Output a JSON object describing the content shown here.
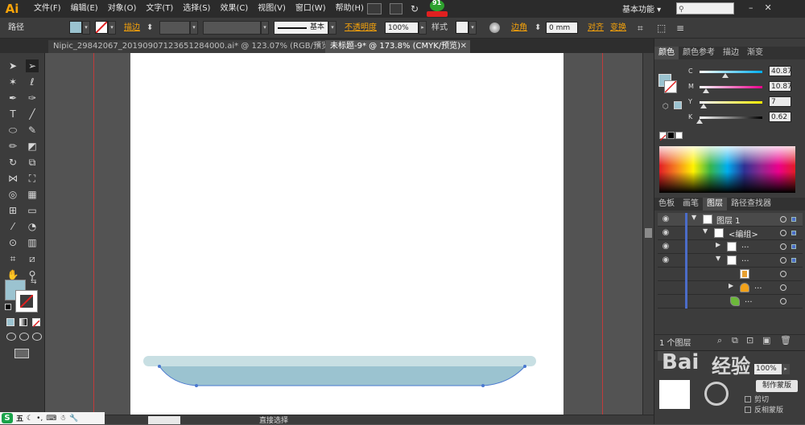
{
  "app": {
    "logo": "Ai"
  },
  "menu": {
    "items": [
      "文件(F)",
      "编辑(E)",
      "对象(O)",
      "文字(T)",
      "选择(S)",
      "效果(C)",
      "视图(V)",
      "窗口(W)",
      "帮助(H)"
    ],
    "workspace": "基本功能",
    "badge": "91"
  },
  "controlbar": {
    "selection_label": "路径",
    "stroke_label": "描边",
    "stroke_style": "基本",
    "opacity_label": "不透明度",
    "opacity_value": "100%",
    "style_label": "样式",
    "corner_label": "边角",
    "corner_value": "0 mm",
    "align_label": "对齐",
    "transform_label": "变换",
    "fill_color": "#9bc3d0"
  },
  "tabs": [
    {
      "label": "Nipic_29842067_20190907123651284000.ai* @ 123.07% (RGB/预览)",
      "active": false
    },
    {
      "label": "未标题-9* @ 173.8% (CMYK/预览)",
      "active": true
    }
  ],
  "color_panel": {
    "tabs": [
      "颜色",
      "颜色参考",
      "描边",
      "渐变"
    ],
    "active_tab": "颜色",
    "sliders": [
      {
        "channel": "C",
        "value": "40.87",
        "percent": 40.87
      },
      {
        "channel": "M",
        "value": "10.87",
        "percent": 10.87
      },
      {
        "channel": "Y",
        "value": "7",
        "percent": 7
      },
      {
        "channel": "K",
        "value": "0.62",
        "percent": 0.62
      }
    ],
    "fill_color": "#9bc3d0"
  },
  "layers_panel": {
    "tabs": [
      "色板",
      "画笔",
      "图层",
      "路径查找器"
    ],
    "active_tab": "图层",
    "rows": [
      {
        "name": "图层 1",
        "visible": true
      },
      {
        "name": "<编组>",
        "visible": true
      },
      {
        "name": "...",
        "visible": true
      },
      {
        "name": "...",
        "visible": true
      },
      {
        "name": "",
        "visible": false
      },
      {
        "name": "...",
        "visible": false
      },
      {
        "name": "...",
        "visible": false
      }
    ],
    "footer_label": "1 个图层"
  },
  "transparency_panel": {
    "opacity_value": "100%",
    "make_mask": "制作蒙版",
    "clip": "剪切",
    "invert_mask": "反相蒙版"
  },
  "status": {
    "tool_name": "直接选择"
  },
  "taskbar": {
    "ime_label": "五"
  },
  "watermark_text": "经验",
  "artwork": {
    "rim_color": "#c8dfe3",
    "body_color": "#9bc3d0"
  }
}
